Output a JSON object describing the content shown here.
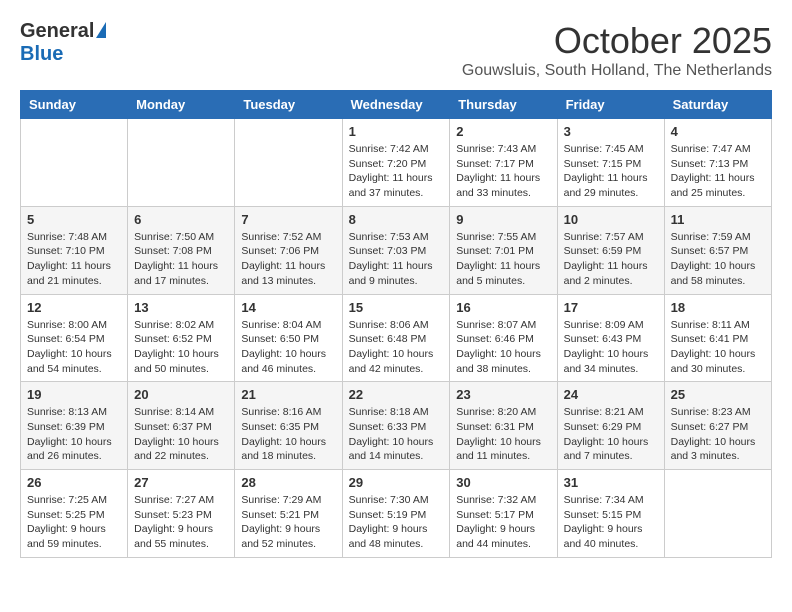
{
  "header": {
    "logo_general": "General",
    "logo_blue": "Blue",
    "month_title": "October 2025",
    "subtitle": "Gouwsluis, South Holland, The Netherlands"
  },
  "weekdays": [
    "Sunday",
    "Monday",
    "Tuesday",
    "Wednesday",
    "Thursday",
    "Friday",
    "Saturday"
  ],
  "weeks": [
    [
      {
        "day": "",
        "info": ""
      },
      {
        "day": "",
        "info": ""
      },
      {
        "day": "",
        "info": ""
      },
      {
        "day": "1",
        "info": "Sunrise: 7:42 AM\nSunset: 7:20 PM\nDaylight: 11 hours\nand 37 minutes."
      },
      {
        "day": "2",
        "info": "Sunrise: 7:43 AM\nSunset: 7:17 PM\nDaylight: 11 hours\nand 33 minutes."
      },
      {
        "day": "3",
        "info": "Sunrise: 7:45 AM\nSunset: 7:15 PM\nDaylight: 11 hours\nand 29 minutes."
      },
      {
        "day": "4",
        "info": "Sunrise: 7:47 AM\nSunset: 7:13 PM\nDaylight: 11 hours\nand 25 minutes."
      }
    ],
    [
      {
        "day": "5",
        "info": "Sunrise: 7:48 AM\nSunset: 7:10 PM\nDaylight: 11 hours\nand 21 minutes."
      },
      {
        "day": "6",
        "info": "Sunrise: 7:50 AM\nSunset: 7:08 PM\nDaylight: 11 hours\nand 17 minutes."
      },
      {
        "day": "7",
        "info": "Sunrise: 7:52 AM\nSunset: 7:06 PM\nDaylight: 11 hours\nand 13 minutes."
      },
      {
        "day": "8",
        "info": "Sunrise: 7:53 AM\nSunset: 7:03 PM\nDaylight: 11 hours\nand 9 minutes."
      },
      {
        "day": "9",
        "info": "Sunrise: 7:55 AM\nSunset: 7:01 PM\nDaylight: 11 hours\nand 5 minutes."
      },
      {
        "day": "10",
        "info": "Sunrise: 7:57 AM\nSunset: 6:59 PM\nDaylight: 11 hours\nand 2 minutes."
      },
      {
        "day": "11",
        "info": "Sunrise: 7:59 AM\nSunset: 6:57 PM\nDaylight: 10 hours\nand 58 minutes."
      }
    ],
    [
      {
        "day": "12",
        "info": "Sunrise: 8:00 AM\nSunset: 6:54 PM\nDaylight: 10 hours\nand 54 minutes."
      },
      {
        "day": "13",
        "info": "Sunrise: 8:02 AM\nSunset: 6:52 PM\nDaylight: 10 hours\nand 50 minutes."
      },
      {
        "day": "14",
        "info": "Sunrise: 8:04 AM\nSunset: 6:50 PM\nDaylight: 10 hours\nand 46 minutes."
      },
      {
        "day": "15",
        "info": "Sunrise: 8:06 AM\nSunset: 6:48 PM\nDaylight: 10 hours\nand 42 minutes."
      },
      {
        "day": "16",
        "info": "Sunrise: 8:07 AM\nSunset: 6:46 PM\nDaylight: 10 hours\nand 38 minutes."
      },
      {
        "day": "17",
        "info": "Sunrise: 8:09 AM\nSunset: 6:43 PM\nDaylight: 10 hours\nand 34 minutes."
      },
      {
        "day": "18",
        "info": "Sunrise: 8:11 AM\nSunset: 6:41 PM\nDaylight: 10 hours\nand 30 minutes."
      }
    ],
    [
      {
        "day": "19",
        "info": "Sunrise: 8:13 AM\nSunset: 6:39 PM\nDaylight: 10 hours\nand 26 minutes."
      },
      {
        "day": "20",
        "info": "Sunrise: 8:14 AM\nSunset: 6:37 PM\nDaylight: 10 hours\nand 22 minutes."
      },
      {
        "day": "21",
        "info": "Sunrise: 8:16 AM\nSunset: 6:35 PM\nDaylight: 10 hours\nand 18 minutes."
      },
      {
        "day": "22",
        "info": "Sunrise: 8:18 AM\nSunset: 6:33 PM\nDaylight: 10 hours\nand 14 minutes."
      },
      {
        "day": "23",
        "info": "Sunrise: 8:20 AM\nSunset: 6:31 PM\nDaylight: 10 hours\nand 11 minutes."
      },
      {
        "day": "24",
        "info": "Sunrise: 8:21 AM\nSunset: 6:29 PM\nDaylight: 10 hours\nand 7 minutes."
      },
      {
        "day": "25",
        "info": "Sunrise: 8:23 AM\nSunset: 6:27 PM\nDaylight: 10 hours\nand 3 minutes."
      }
    ],
    [
      {
        "day": "26",
        "info": "Sunrise: 7:25 AM\nSunset: 5:25 PM\nDaylight: 9 hours\nand 59 minutes."
      },
      {
        "day": "27",
        "info": "Sunrise: 7:27 AM\nSunset: 5:23 PM\nDaylight: 9 hours\nand 55 minutes."
      },
      {
        "day": "28",
        "info": "Sunrise: 7:29 AM\nSunset: 5:21 PM\nDaylight: 9 hours\nand 52 minutes."
      },
      {
        "day": "29",
        "info": "Sunrise: 7:30 AM\nSunset: 5:19 PM\nDaylight: 9 hours\nand 48 minutes."
      },
      {
        "day": "30",
        "info": "Sunrise: 7:32 AM\nSunset: 5:17 PM\nDaylight: 9 hours\nand 44 minutes."
      },
      {
        "day": "31",
        "info": "Sunrise: 7:34 AM\nSunset: 5:15 PM\nDaylight: 9 hours\nand 40 minutes."
      },
      {
        "day": "",
        "info": ""
      }
    ]
  ]
}
